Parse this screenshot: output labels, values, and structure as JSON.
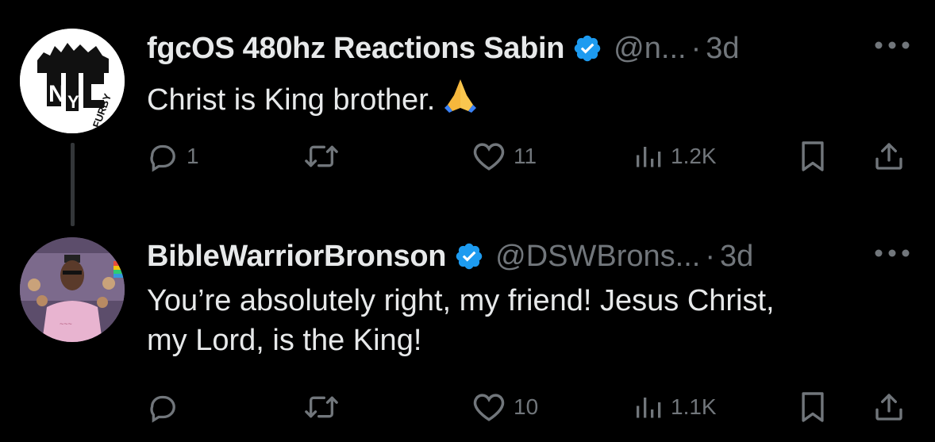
{
  "colors": {
    "background": "#000000",
    "text": "#e7e9ea",
    "muted": "#71767b",
    "verified": "#1d9bf0",
    "thread_line": "#333639"
  },
  "tweets": [
    {
      "display_name": "fgcOS 480hz Reactions Sabin",
      "handle": "@n...",
      "separator": "·",
      "time": "3d",
      "text": "Christ is King brother.",
      "emoji": "folded-hands",
      "avatar": {
        "logo_text": "NYC",
        "logo_subtext": "FURBY"
      },
      "replies": "1",
      "retweets": "",
      "likes": "11",
      "views": "1.2K"
    },
    {
      "display_name": "BibleWarriorBronson",
      "handle": "@DSWBrons...",
      "separator": "·",
      "time": "3d",
      "text_line1": "You’re absolutely right, my friend! Jesus Christ,",
      "text_line2": "my Lord, is the King!",
      "avatar": {
        "description": "illustrated person in pink shirt"
      },
      "replies": "",
      "retweets": "",
      "likes": "10",
      "views": "1.1K"
    }
  ]
}
